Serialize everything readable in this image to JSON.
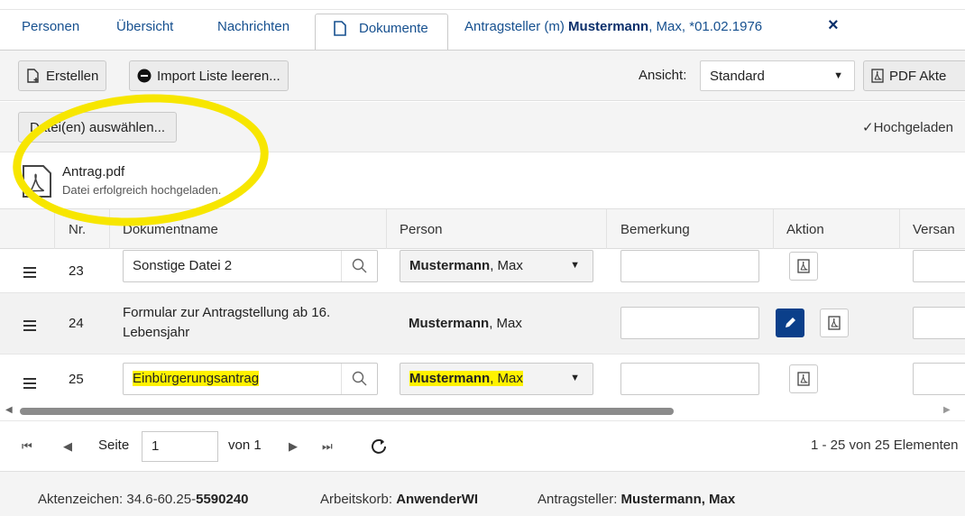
{
  "tabs": {
    "personen": "Personen",
    "uebersicht": "Übersicht",
    "nachrichten": "Nachrichten",
    "dokumente": "Dokumente",
    "antragsteller_prefix": "Antragsteller  (m) ",
    "antragsteller_name": "Mustermann",
    "antragsteller_suffix": ", Max, *01.02.1976",
    "close": "×"
  },
  "toolbar": {
    "erstellen": "Erstellen",
    "import": "Import Liste leeren...",
    "ansicht_label": "Ansicht:",
    "ansicht_value": "Standard",
    "pdf_akte": "PDF Akte"
  },
  "upload": {
    "select_button": "Datei(en) auswählen...",
    "status": "✓Hochgeladen",
    "file_name": "Antrag.pdf",
    "file_status": "Datei erfolgreich hochgeladen."
  },
  "grid": {
    "headers": {
      "nr": "Nr.",
      "name": "Dokumentname",
      "person": "Person",
      "bemerkung": "Bemerkung",
      "aktion": "Aktion",
      "versand": "Versan"
    },
    "rows": [
      {
        "nr": "23",
        "name": "Sonstige Datei 2",
        "person_last": "Mustermann",
        "person_first": ", Max"
      },
      {
        "nr": "24",
        "name_line1": "Formular zur Antragstellung ab 16.",
        "name_line2": "Lebensjahr",
        "person_last": "Mustermann",
        "person_first": ", Max"
      },
      {
        "nr": "25",
        "name": "Einbürgerungsantrag",
        "person_last": "Mustermann",
        "person_first": ", Max"
      }
    ]
  },
  "pager": {
    "seite_label": "Seite",
    "page_value": "1",
    "von": "von 1",
    "summary": "1 - 25 von 25 Elementen"
  },
  "footer": {
    "aktenzeichen_label": "Aktenzeichen: 34.6-60.25-",
    "aktenzeichen_value": "5590240",
    "arbeitskorb_label": "Arbeitskorb: ",
    "arbeitskorb_value": "AnwenderWI",
    "antragsteller_label": "Antragsteller: ",
    "antragsteller_value": "Mustermann, Max"
  },
  "colors": {
    "brand": "#16508f",
    "primary_button": "#0b3f8a",
    "highlight": "#fff200"
  }
}
